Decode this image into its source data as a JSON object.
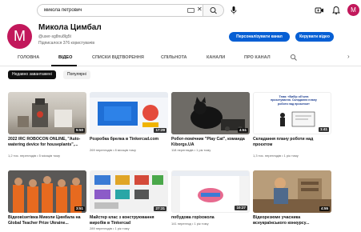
{
  "search": {
    "query": "микола петрович"
  },
  "user": {
    "initial": "M"
  },
  "channel": {
    "initial": "M",
    "name": "Микола Цимбал",
    "handle": "@user-sg8nu8lg5t",
    "subscribers": "Підписалося 376 користувачів",
    "customize_label": "Персоналізувати канал",
    "manage_label": "Керувати відео"
  },
  "tabs": [
    {
      "label": "ГОЛОВНА"
    },
    {
      "label": "ВІДЕО"
    },
    {
      "label": "СПИСКИ ВІДТВОРЕННЯ"
    },
    {
      "label": "СПІЛЬНОТА"
    },
    {
      "label": "КАНАЛИ"
    },
    {
      "label": "ПРО КАНАЛ"
    }
  ],
  "filters": [
    {
      "label": "Недавно завантажені"
    },
    {
      "label": "Популярні"
    }
  ],
  "videos": [
    {
      "title": "2022 IRC ROBOCON ONLINE, \"Auto-watering device for houseplants\",...",
      "meta": "1,2 тис. переглядів • 5 місяців тому",
      "duration": "5:50"
    },
    {
      "title": "Розробка брелка в Tinkercad.com",
      "meta": "269 переглядів • 8 місяців тому",
      "duration": "17:29"
    },
    {
      "title": "Робот-помічник \"Play Cat\", команда Kiborgs.UA",
      "meta": "118 переглядів • 1 рік тому",
      "duration": "4:51"
    },
    {
      "title": "Складання плану роботи над проєктом",
      "meta": "1,3 тис. переглядів • 1 рік тому",
      "duration": "1:41"
    },
    {
      "title": "Відеовізитівка Миколи Цимбала на Global Teacher Prize Ukraine...",
      "meta": "",
      "duration": "3:51"
    },
    {
      "title": "Майстер клас з конструювання виробів в Tinkercad",
      "meta": "289 переглядів • 1 рік тому",
      "duration": "27:31"
    },
    {
      "title": "побудова горіхокола",
      "meta": "141 перегляд • 1 рік тому",
      "duration": "10:27"
    },
    {
      "title": "Відеорезюме учасника всеукраїнського конкурсу...",
      "meta": "",
      "duration": "4:55"
    }
  ],
  "thumb4_text": "Тема: «Вибір об'єкта проєктування. Складання плану роботи над проєктом»",
  "colors": {
    "accent": "#065fd4",
    "avatar": "#c2185b"
  }
}
